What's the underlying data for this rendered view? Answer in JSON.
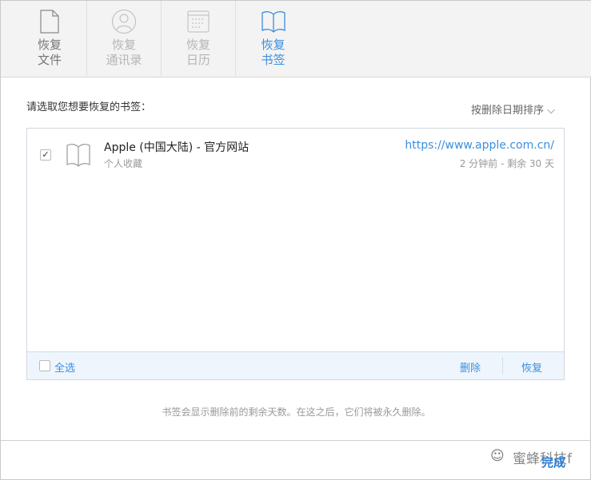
{
  "tabs": [
    {
      "line1": "恢复",
      "line2": "文件",
      "icon": "file-icon"
    },
    {
      "line1": "恢复",
      "line2": "通讯录",
      "icon": "contacts-icon"
    },
    {
      "line1": "恢复",
      "line2": "日历",
      "icon": "calendar-icon"
    },
    {
      "line1": "恢复",
      "line2": "书签",
      "icon": "bookmarks-icon"
    }
  ],
  "prompt": "请选取您想要恢复的书签：",
  "sort_label": "按删除日期排序",
  "items": [
    {
      "title": "Apple (中国大陆) - 官方网站",
      "folder": "个人收藏",
      "url": "https://www.apple.com.cn/",
      "age": "2 分钟前 - 剩余 30 天",
      "checked": true
    }
  ],
  "footer": {
    "select_all": "全选",
    "delete": "删除",
    "restore": "恢复"
  },
  "note": "书签会显示删除前的剩余天数。在这之后，它们将被永久删除。",
  "done": "完成",
  "watermark": "蜜蜂科技f",
  "colors": {
    "accent": "#3b8fe0"
  }
}
